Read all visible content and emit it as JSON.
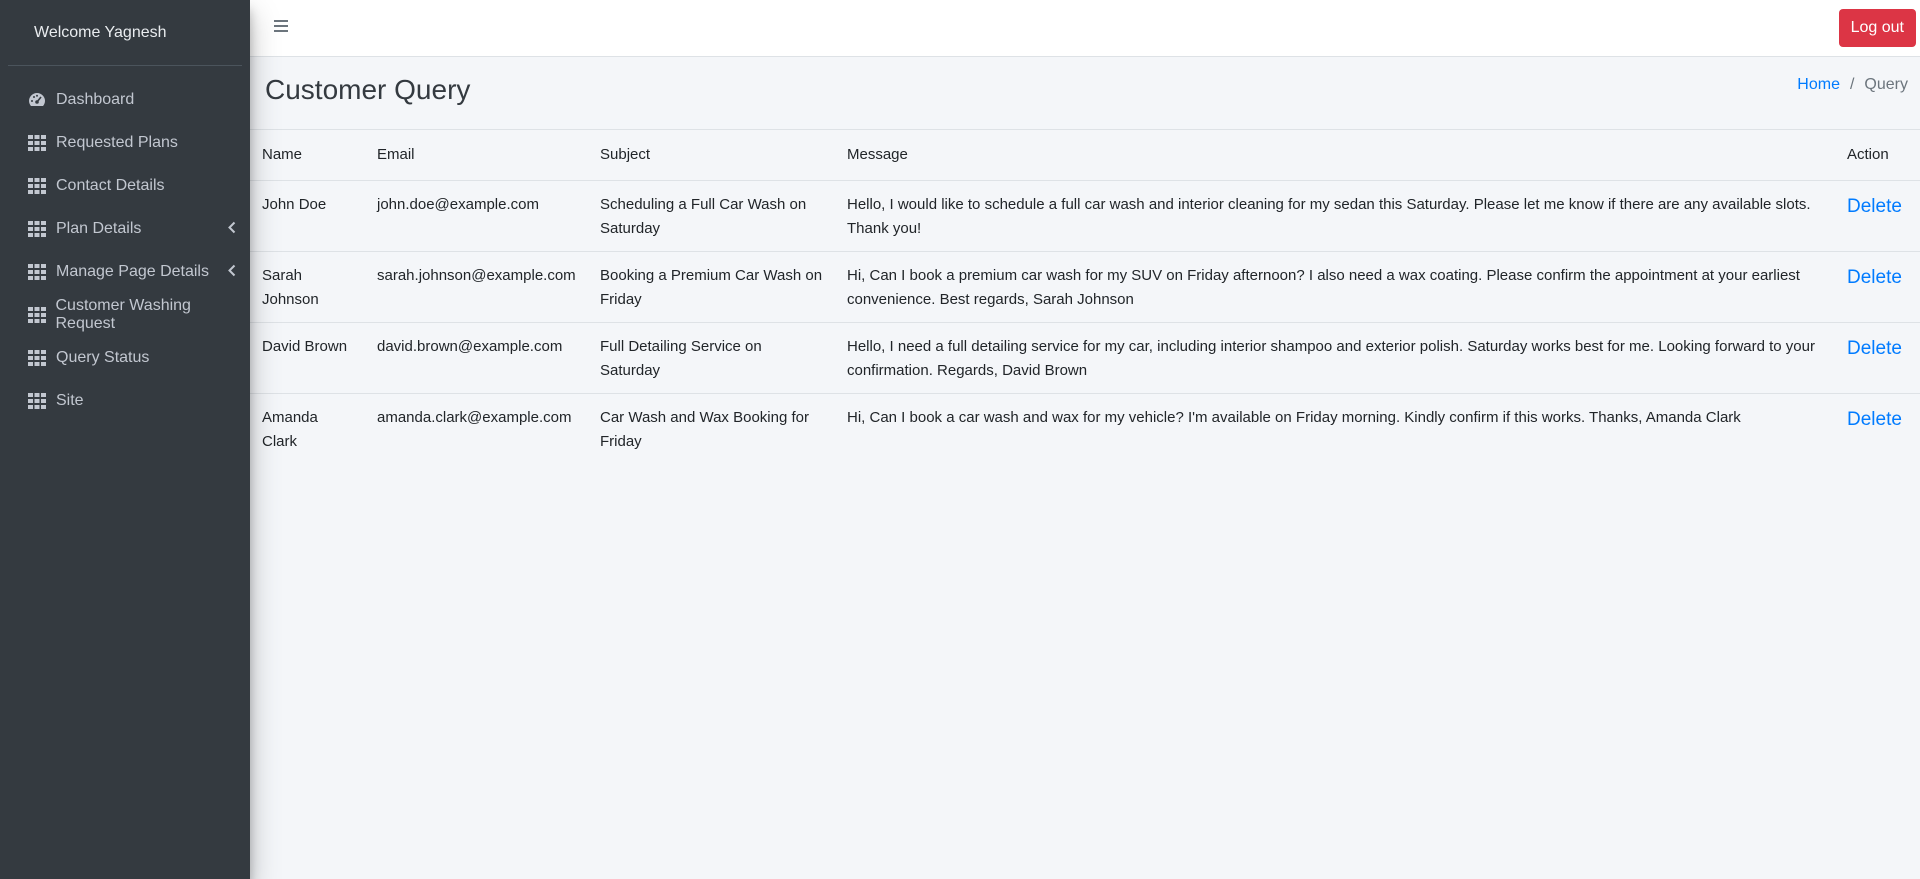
{
  "sidebar": {
    "welcome": "Welcome Yagnesh",
    "items": [
      {
        "label": "Dashboard",
        "icon": "dashboard-gauge-icon"
      },
      {
        "label": "Requested Plans",
        "icon": "grid-icon"
      },
      {
        "label": "Contact Details",
        "icon": "grid-icon"
      },
      {
        "label": "Plan Details",
        "icon": "grid-icon",
        "has_chevron": true
      },
      {
        "label": "Manage Page Details",
        "icon": "grid-icon",
        "has_chevron": true
      },
      {
        "label": "Customer Washing Request",
        "icon": "grid-icon"
      },
      {
        "label": "Query Status",
        "icon": "grid-icon"
      },
      {
        "label": "Site",
        "icon": "grid-icon"
      }
    ]
  },
  "topbar": {
    "logout_label": "Log out"
  },
  "header": {
    "title": "Customer Query",
    "breadcrumb": {
      "home": "Home",
      "separator": "/",
      "current": "Query"
    }
  },
  "table": {
    "columns": {
      "name": "Name",
      "email": "Email",
      "subject": "Subject",
      "message": "Message",
      "action": "Action"
    },
    "rows": [
      {
        "name": "John Doe",
        "email": "john.doe@example.com",
        "subject": "Scheduling a Full Car Wash on Saturday",
        "message": "Hello, I would like to schedule a full car wash and interior cleaning for my sedan this Saturday. Please let me know if there are any available slots. Thank you!",
        "action": "Delete"
      },
      {
        "name": "Sarah Johnson",
        "email": "sarah.johnson@example.com",
        "subject": "Booking a Premium Car Wash on Friday",
        "message": "Hi, Can I book a premium car wash for my SUV on Friday afternoon? I also need a wax coating. Please confirm the appointment at your earliest convenience. Best regards, Sarah Johnson",
        "action": "Delete"
      },
      {
        "name": "David Brown",
        "email": "david.brown@example.com",
        "subject": "Full Detailing Service on Saturday",
        "message": "Hello, I need a full detailing service for my car, including interior shampoo and exterior polish. Saturday works best for me. Looking forward to your confirmation. Regards, David Brown",
        "action": "Delete"
      },
      {
        "name": "Amanda Clark",
        "email": "amanda.clark@example.com",
        "subject": "Car Wash and Wax Booking for Friday",
        "message": "Hi, Can I book a car wash and wax for my vehicle? I'm available on Friday morning. Kindly confirm if this works. Thanks, Amanda Clark",
        "action": "Delete"
      }
    ]
  },
  "colors": {
    "sidebar_bg": "#343a40",
    "sidebar_text": "#c2c7d0",
    "link": "#007bff",
    "danger": "#dc3545",
    "page_bg": "#f4f6f9"
  }
}
